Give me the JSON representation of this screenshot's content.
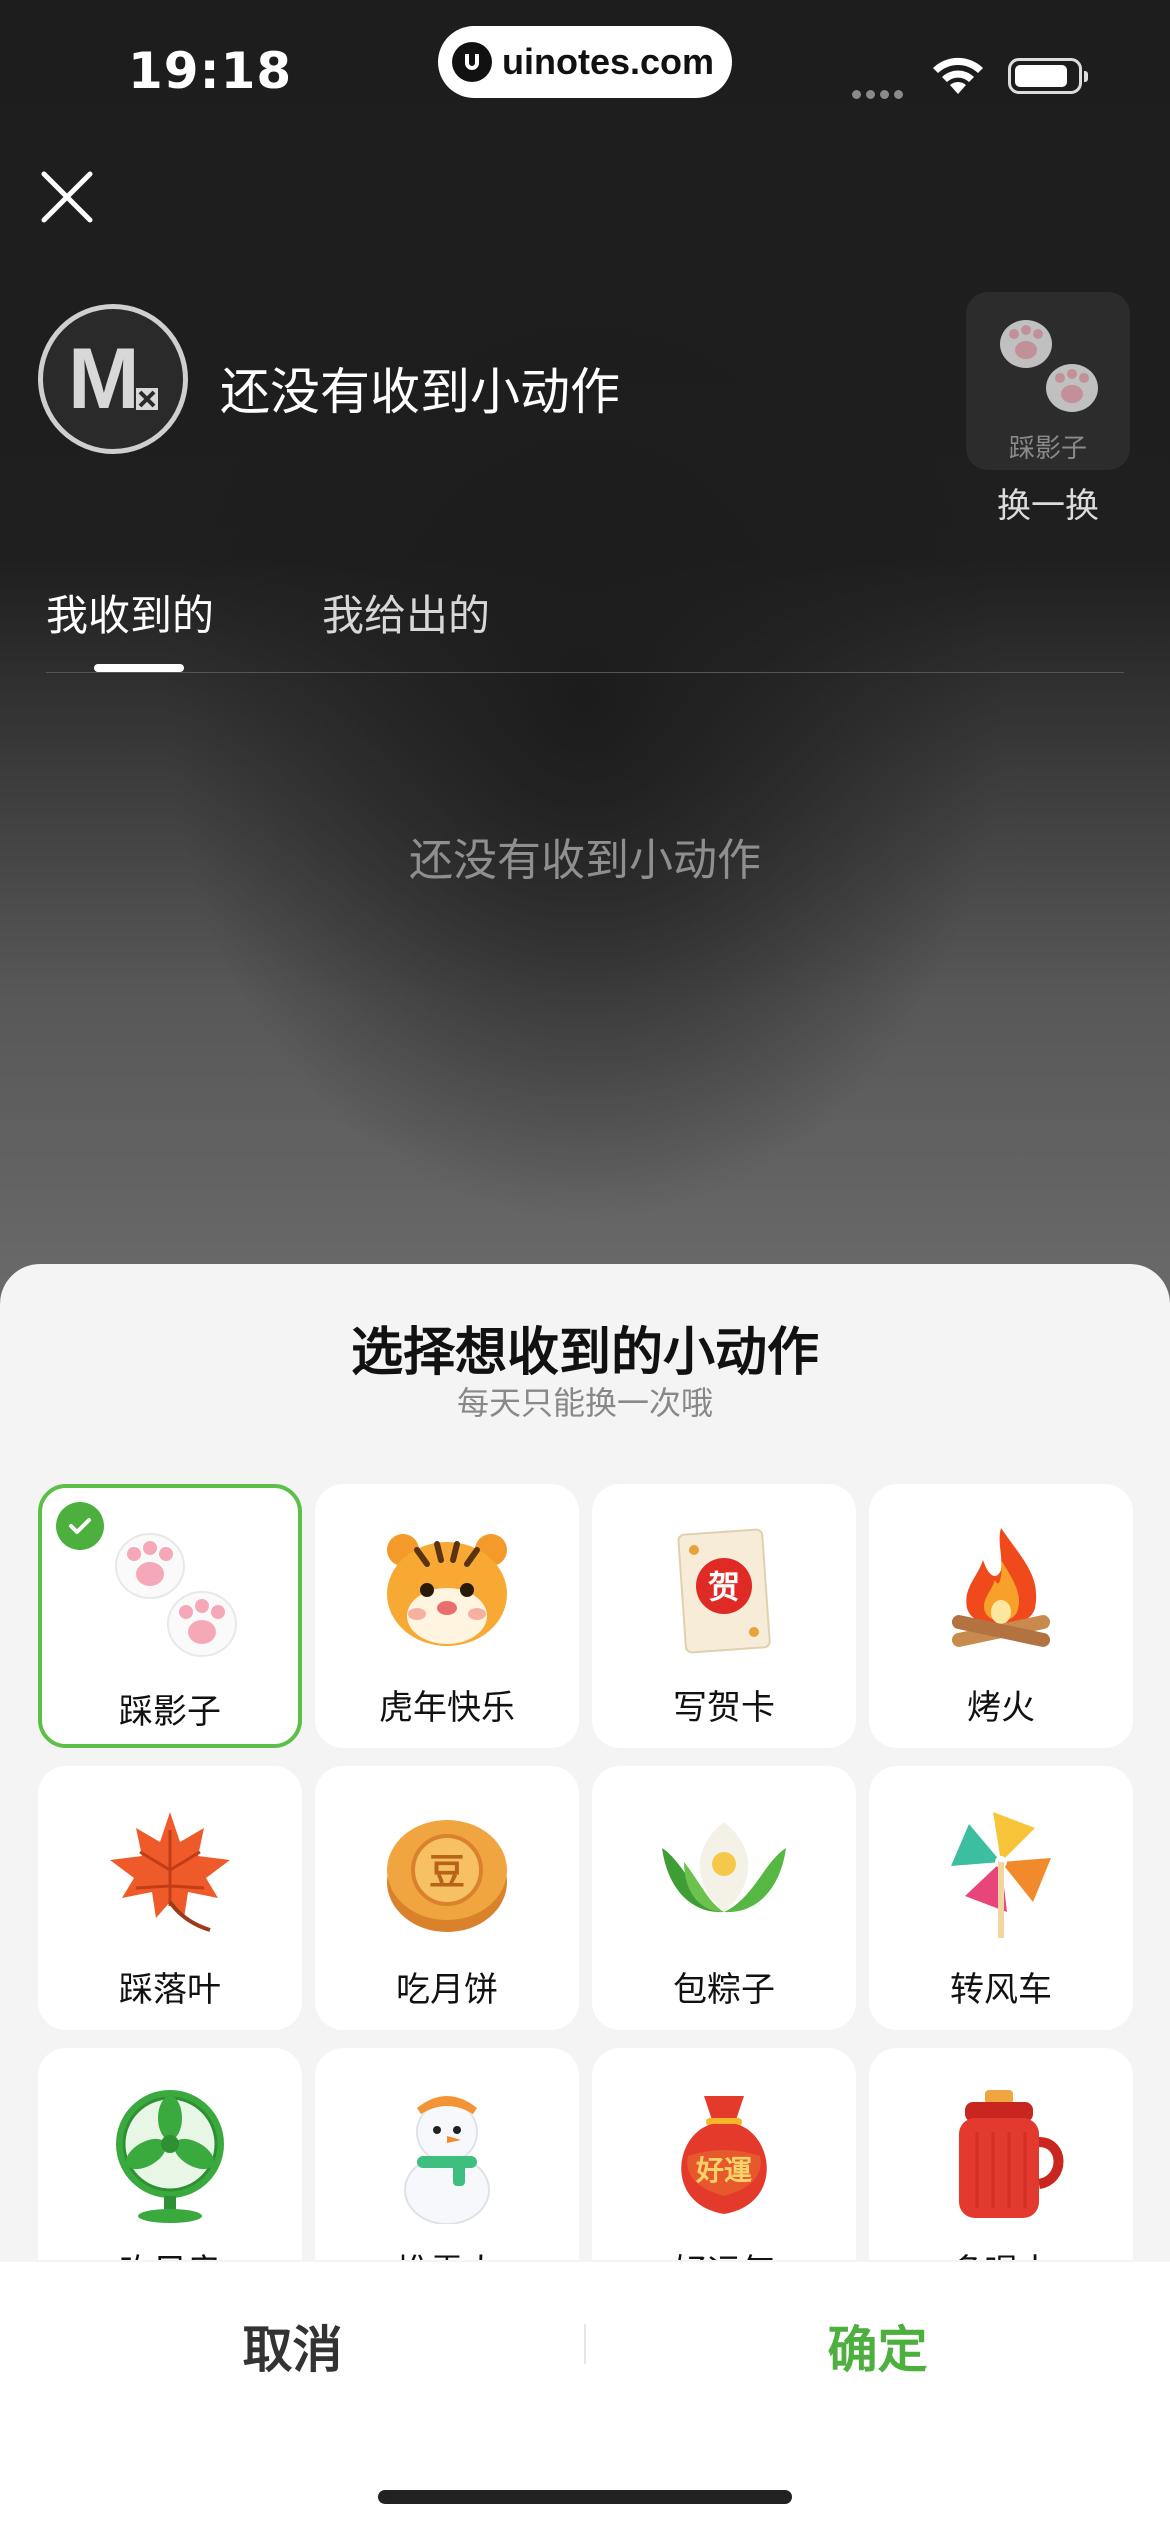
{
  "status": {
    "time": "19:18",
    "brand": "uinotes.com"
  },
  "header": {
    "avatar_text": "M",
    "title": "还没有收到小动作",
    "swap_card_label": "踩影子",
    "swap_label": "换一换"
  },
  "tabs": [
    {
      "label": "我收到的",
      "active": true
    },
    {
      "label": "我给出的",
      "active": false
    }
  ],
  "empty_text": "还没有收到小动作",
  "sheet": {
    "title": "选择想收到的小动作",
    "subtitle": "每天只能换一次哦",
    "actions": [
      {
        "label": "踩影子",
        "icon": "paw-prints-icon",
        "selected": true
      },
      {
        "label": "虎年快乐",
        "icon": "tiger-icon",
        "selected": false
      },
      {
        "label": "写贺卡",
        "icon": "greeting-card-icon",
        "selected": false,
        "icon_text": "贺"
      },
      {
        "label": "烤火",
        "icon": "campfire-icon",
        "selected": false
      },
      {
        "label": "踩落叶",
        "icon": "maple-leaf-icon",
        "selected": false
      },
      {
        "label": "吃月饼",
        "icon": "mooncake-icon",
        "selected": false,
        "icon_text": "豆"
      },
      {
        "label": "包粽子",
        "icon": "zongzi-icon",
        "selected": false
      },
      {
        "label": "转风车",
        "icon": "pinwheel-icon",
        "selected": false
      },
      {
        "label": "吹风扇",
        "icon": "fan-icon",
        "selected": false
      },
      {
        "label": "堆雪人",
        "icon": "snowman-icon",
        "selected": false
      },
      {
        "label": "好运气",
        "icon": "lucky-bag-icon",
        "selected": false,
        "icon_text": "好運"
      },
      {
        "label": "多喝水",
        "icon": "thermos-icon",
        "selected": false
      }
    ],
    "cancel_label": "取消",
    "confirm_label": "确定"
  },
  "colors": {
    "accent": "#4caf3e",
    "selected_border": "#5bbf48"
  }
}
